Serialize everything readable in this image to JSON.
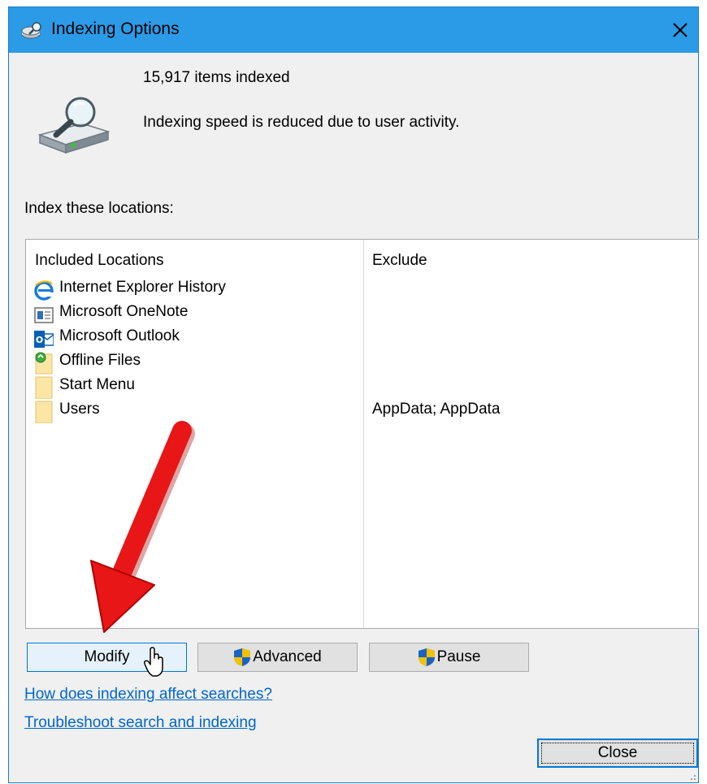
{
  "window": {
    "title": "Indexing Options",
    "title_icon": "indexing-options-icon",
    "close_glyph": "✕",
    "accent_color": "#2b9be8"
  },
  "status": {
    "icon": "search-drive-icon",
    "items_indexed": "15,917 items indexed",
    "message": "Indexing speed is reduced due to user activity."
  },
  "locations": {
    "label": "Index these locations:",
    "columns": {
      "included": "Included Locations",
      "exclude": "Exclude"
    },
    "rows": [
      {
        "name": "Internet Explorer History",
        "icon": "internet-explorer-icon",
        "exclude": ""
      },
      {
        "name": "Microsoft OneNote",
        "icon": "onenote-icon",
        "exclude": ""
      },
      {
        "name": "Microsoft Outlook",
        "icon": "outlook-icon",
        "exclude": ""
      },
      {
        "name": "Offline Files",
        "icon": "offline-files-folder-icon",
        "exclude": ""
      },
      {
        "name": "Start Menu",
        "icon": "folder-icon",
        "exclude": ""
      },
      {
        "name": "Users",
        "icon": "folder-icon",
        "exclude": "AppData; AppData"
      }
    ]
  },
  "buttons": {
    "modify": "Modify",
    "advanced": "Advanced",
    "pause": "Pause",
    "close": "Close"
  },
  "links": {
    "how_affects": "How does indexing affect searches?",
    "troubleshoot": "Troubleshoot search and indexing"
  },
  "annotation": {
    "arrow_color": "#ee1111"
  }
}
